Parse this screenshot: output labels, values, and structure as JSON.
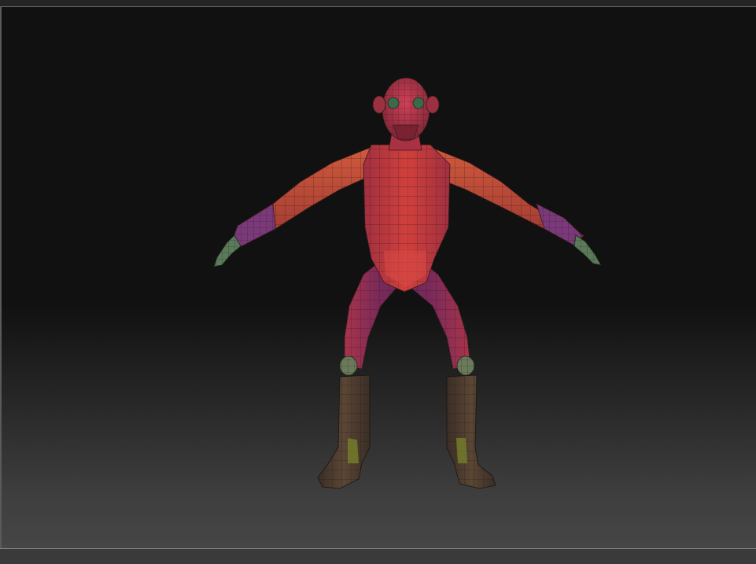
{
  "viewport": {
    "label": "",
    "colors": {
      "torso": "#c0383c",
      "torso_dark": "#8c2a38",
      "arm_upper": "#c04a38",
      "forearm": "#7a3a7a",
      "hand": "#6a8a6a",
      "head": "#b0324a",
      "eye": "#3a6a4a",
      "leg": "#7a2a52",
      "leg_light": "#b03a4a",
      "boot": "#4a3a2e",
      "boot_highlight": "#7a8a2a",
      "wire": "#3a1a1a"
    }
  }
}
